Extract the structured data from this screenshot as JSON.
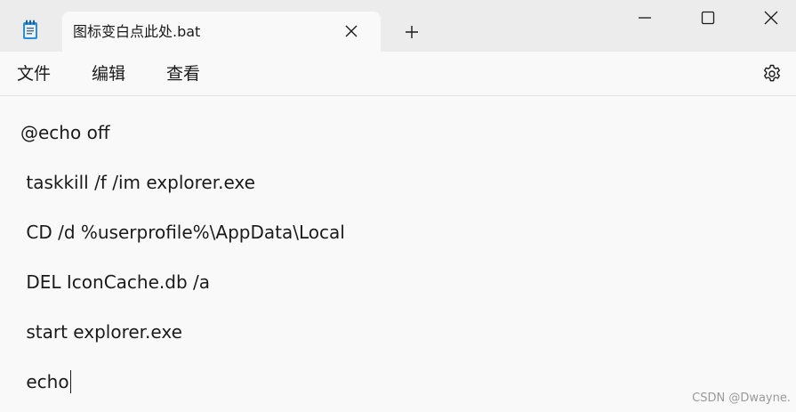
{
  "titlebar": {
    "app_icon": "notepad-icon",
    "tab_title": "图标变白点此处.bat",
    "close_tab_icon": "close-icon",
    "new_tab_icon": "plus-icon",
    "minimize_icon": "minimize-icon",
    "maximize_icon": "maximize-icon",
    "close_window_icon": "close-icon"
  },
  "menu": {
    "file": "文件",
    "edit": "编辑",
    "view": "查看",
    "settings_icon": "gear-icon"
  },
  "editor": {
    "lines": [
      "@echo off",
      " taskkill /f /im explorer.exe",
      " CD /d %userprofile%\\AppData\\Local",
      " DEL IconCache.db /a",
      " start explorer.exe",
      " echo"
    ]
  },
  "watermark": "CSDN @Dwayne."
}
